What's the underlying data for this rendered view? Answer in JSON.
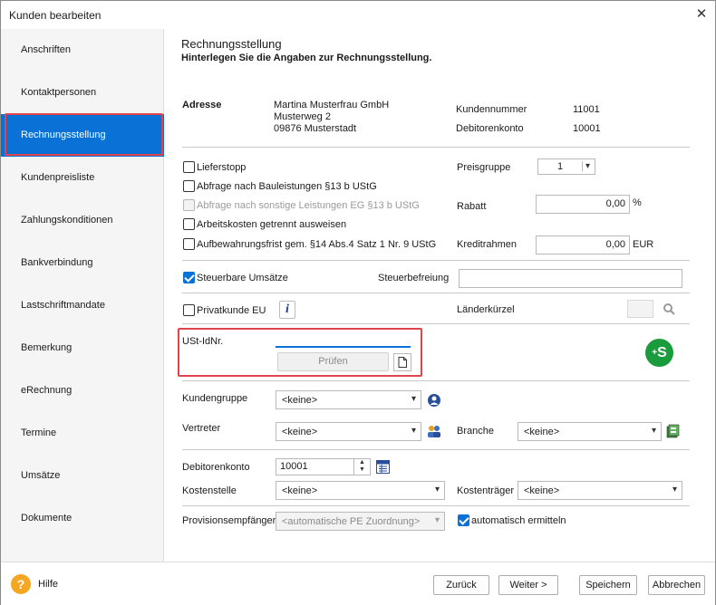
{
  "window": {
    "title": "Kunden bearbeiten"
  },
  "sidebar": {
    "items": [
      {
        "label": "Anschriften"
      },
      {
        "label": "Kontaktpersonen"
      },
      {
        "label": "Rechnungsstellung"
      },
      {
        "label": "Kundenpreisliste"
      },
      {
        "label": "Zahlungskonditionen"
      },
      {
        "label": "Bankverbindung"
      },
      {
        "label": "Lastschriftmandate"
      },
      {
        "label": "Bemerkung"
      },
      {
        "label": "eRechnung"
      },
      {
        "label": "Termine"
      },
      {
        "label": "Umsätze"
      },
      {
        "label": "Dokumente"
      }
    ]
  },
  "main": {
    "title": "Rechnungsstellung",
    "subtitle": "Hinterlegen Sie die Angaben zur Rechnungsstellung.",
    "address": {
      "label": "Adresse",
      "line1": "Martina Musterfrau GmbH",
      "line2": "Musterweg 2",
      "line3": "09876 Musterstadt"
    },
    "kundennummer": {
      "label": "Kundennummer",
      "value": "11001"
    },
    "debitorenkonto_info": {
      "label": "Debitorenkonto",
      "value": "10001"
    },
    "options": {
      "lieferstopp": "Lieferstopp",
      "bauleistungen": "Abfrage nach Bauleistungen §13 b UStG",
      "sonstige": "Abfrage nach sonstige Leistungen EG §13 b UStG",
      "arbeitskosten": "Arbeitskosten getrennt ausweisen",
      "aufbewahrung": "Aufbewahrungsfrist gem. §14 Abs.4 Satz 1 Nr. 9 UStG"
    },
    "preisgruppe": {
      "label": "Preisgruppe",
      "value": "1"
    },
    "rabatt": {
      "label": "Rabatt",
      "value": "0,00",
      "unit": "%"
    },
    "kreditrahmen": {
      "label": "Kreditrahmen",
      "value": "0,00",
      "unit": "EUR"
    },
    "steuerbar": {
      "label": "Steuerbare Umsätze",
      "checked": true
    },
    "steuerbefreiung": {
      "label": "Steuerbefreiung",
      "value": ""
    },
    "privatkunde": {
      "label": "Privatkunde EU"
    },
    "laenderkuerzel": {
      "label": "Länderkürzel",
      "value": ""
    },
    "ustid": {
      "label": "USt-IdNr.",
      "value": "",
      "check_label": "Prüfen"
    },
    "kundengruppe": {
      "label": "Kundengruppe",
      "value": "<keine>"
    },
    "vertreter": {
      "label": "Vertreter",
      "value": "<keine>"
    },
    "branche": {
      "label": "Branche",
      "value": "<keine>"
    },
    "debitorenkonto": {
      "label": "Debitorenkonto",
      "value": "10001"
    },
    "kostenstelle": {
      "label": "Kostenstelle",
      "value": "<keine>"
    },
    "kostentraeger": {
      "label": "Kostenträger",
      "value": "<keine>"
    },
    "provision": {
      "label": "Provisionsempfänger",
      "value": "<automatische PE Zuordnung>"
    },
    "auto": {
      "label": "automatisch ermitteln",
      "checked": true
    }
  },
  "footer": {
    "help": "Hilfe",
    "back": "Zurück",
    "next": "Weiter >",
    "save": "Speichern",
    "cancel": "Abbrechen"
  },
  "colors": {
    "accent": "#0a72d6",
    "highlight": "#e0454f",
    "green": "#1a9b3c",
    "help": "#f5a623"
  }
}
